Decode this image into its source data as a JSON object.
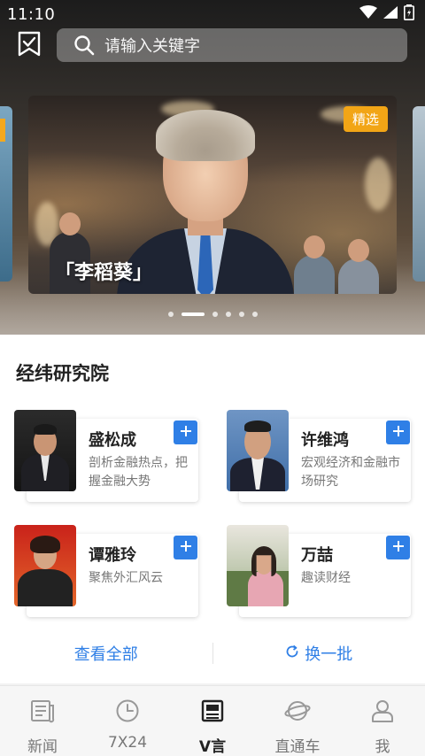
{
  "status_bar": {
    "time": "11:10"
  },
  "search": {
    "placeholder": "请输入关键字"
  },
  "banner": {
    "badge": "精选",
    "caption": "「李稻葵」",
    "dots_count": 6,
    "active_dot": 1
  },
  "section": {
    "title": "经纬研究院",
    "authors": [
      {
        "name": "盛松成",
        "desc": "剖析金融热点，把握金融大势"
      },
      {
        "name": "许维鸿",
        "desc": "宏观经济和金融市场研究"
      },
      {
        "name": "谭雅玲",
        "desc": "聚焦外汇风云"
      },
      {
        "name": "万喆",
        "desc": "趣读财经"
      }
    ],
    "view_all": "查看全部",
    "refresh": "换一批"
  },
  "bottom_nav": {
    "items": [
      {
        "label": "新闻",
        "icon": "news-icon"
      },
      {
        "label": "7X24",
        "icon": "clock-icon"
      },
      {
        "label": "V言",
        "icon": "column-icon"
      },
      {
        "label": "直通车",
        "icon": "planet-icon"
      },
      {
        "label": "我",
        "icon": "profile-icon"
      }
    ],
    "active_index": 2
  },
  "colors": {
    "accent": "#2f7fe6",
    "badge": "#f2a516",
    "active_nav": "#222222",
    "inactive_nav": "#777777"
  }
}
